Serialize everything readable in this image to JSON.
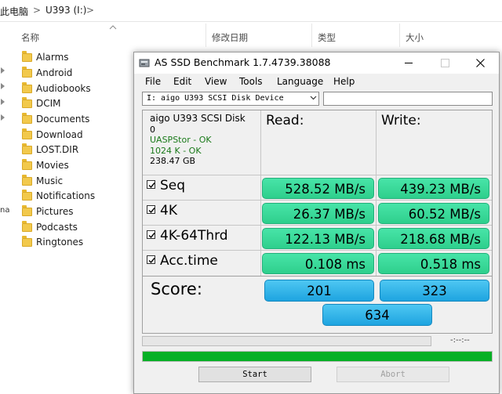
{
  "explorer": {
    "breadcrumb": {
      "parent": "此电脑",
      "sep1": ">",
      "drive": "U393 (I:)",
      "sep2": ">"
    },
    "columns": {
      "name": "名称",
      "modified": "修改日期",
      "type": "类型",
      "size": "大小"
    },
    "folders": [
      "Alarms",
      "Android",
      "Audiobooks",
      "DCIM",
      "Documents",
      "Download",
      "LOST.DIR",
      "Movies",
      "Music",
      "Notifications",
      "Pictures",
      "Podcasts",
      "Ringtones"
    ],
    "edge_text": "na"
  },
  "window": {
    "title": "AS SSD Benchmark 1.7.4739.38088",
    "menu": [
      "File",
      "Edit",
      "View",
      "Tools",
      "Language",
      "Help"
    ],
    "drive_select": "I: aigo U393 SCSI Disk Device",
    "info": {
      "device": "aigo U393 SCSI Disk",
      "index": "0",
      "driver": "UASPStor - OK",
      "alignment": "1024 K - OK",
      "capacity": "238.47 GB"
    },
    "headers": {
      "read": "Read:",
      "write": "Write:"
    },
    "rows": [
      {
        "label": "Seq",
        "read": "528.52 MB/s",
        "write": "439.23 MB/s"
      },
      {
        "label": "4K",
        "read": "26.37 MB/s",
        "write": "60.52 MB/s"
      },
      {
        "label": "4K-64Thrd",
        "read": "122.13 MB/s",
        "write": "218.68 MB/s"
      },
      {
        "label": "Acc.time",
        "read": "0.108 ms",
        "write": "0.518 ms"
      }
    ],
    "score": {
      "label": "Score:",
      "read": "201",
      "write": "323",
      "total": "634"
    },
    "time_text": "-:--:--",
    "progress_top": 0,
    "progress_bottom": 1.0,
    "buttons": {
      "start": "Start",
      "abort": "Abort"
    },
    "colors": {
      "result": "#2ecf8c",
      "score": "#1ea4e0",
      "progress": "#06b025"
    }
  }
}
